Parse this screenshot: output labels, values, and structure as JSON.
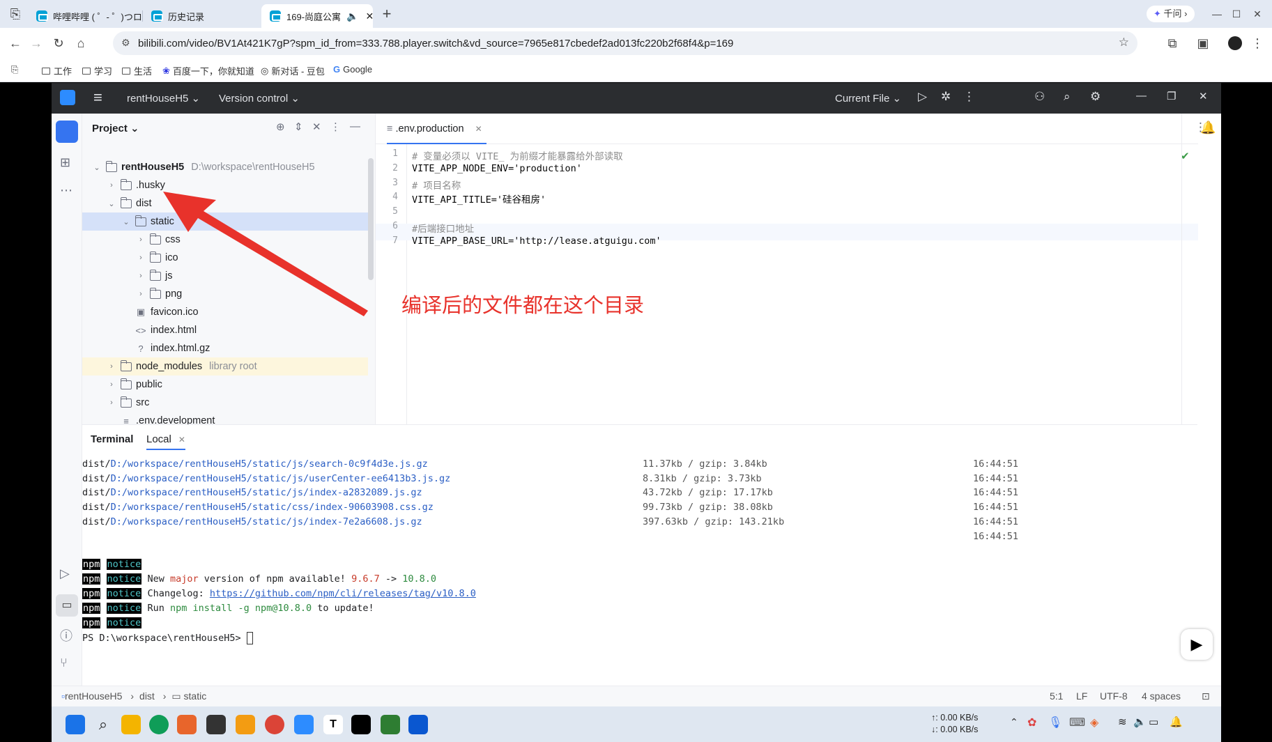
{
  "browser": {
    "tabs": [
      {
        "title": "哔哩哔哩 ( ゜- ゜)つロ 干杯~-bilibili",
        "active": false
      },
      {
        "title": "历史记录",
        "active": false
      },
      {
        "title": "169-尚庭公寓",
        "active": true
      }
    ],
    "qianwen_label": "千问",
    "url": "bilibili.com/video/BV1At421K7gP?spm_id_from=333.788.player.switch&vd_source=7965e817cbedef2ad013fc220b2f68f4&p=169",
    "bookmarks": [
      "工作",
      "学习",
      "生活",
      "百度一下，你就知道",
      "新对话 - 豆包",
      "Google"
    ]
  },
  "ide": {
    "project_name": "rentHouseH5",
    "version_control": "Version control",
    "run_config": "Current File",
    "project_panel_title": "Project",
    "tree": [
      {
        "name": "rentHouseH5",
        "extra": "D:\\workspace\\rentHouseH5",
        "depth": 0,
        "open": true,
        "type": "folder"
      },
      {
        "name": ".husky",
        "depth": 1,
        "open": false,
        "type": "folder"
      },
      {
        "name": "dist",
        "depth": 1,
        "open": true,
        "type": "folder"
      },
      {
        "name": "static",
        "depth": 2,
        "open": true,
        "type": "folder",
        "selected": true
      },
      {
        "name": "css",
        "depth": 3,
        "open": false,
        "type": "folder"
      },
      {
        "name": "ico",
        "depth": 3,
        "open": false,
        "type": "folder"
      },
      {
        "name": "js",
        "depth": 3,
        "open": false,
        "type": "folder"
      },
      {
        "name": "png",
        "depth": 3,
        "open": false,
        "type": "folder"
      },
      {
        "name": "favicon.ico",
        "depth": 2,
        "type": "file"
      },
      {
        "name": "index.html",
        "depth": 2,
        "type": "file"
      },
      {
        "name": "index.html.gz",
        "depth": 2,
        "type": "file"
      },
      {
        "name": "node_modules",
        "extra": "library root",
        "depth": 1,
        "open": false,
        "type": "folder",
        "highlight": true
      },
      {
        "name": "public",
        "depth": 1,
        "open": false,
        "type": "folder"
      },
      {
        "name": "src",
        "depth": 1,
        "open": false,
        "type": "folder"
      },
      {
        "name": ".env.development",
        "depth": 1,
        "type": "file"
      }
    ],
    "editor_tab": ".env.production",
    "code": [
      "# 变量必须以 VITE_ 为前缀才能暴露给外部读取",
      "VITE_APP_NODE_ENV='production'",
      "# 项目名称",
      "VITE_API_TITLE='硅谷租房'",
      "",
      "#后端接口地址",
      "VITE_APP_BASE_URL='http://lease.atguigu.com'"
    ],
    "terminal_tabs": [
      "Terminal",
      "Local"
    ],
    "terminal_files": [
      {
        "path": "dist/D:/workspace/rentHouseH5/static/js/search-0c9f4d3e.js.gz",
        "size": "11.37kb / gzip: 3.84kb",
        "time": "16:44:51"
      },
      {
        "path": "dist/D:/workspace/rentHouseH5/static/js/userCenter-ee6413b3.js.gz",
        "size": "8.31kb / gzip: 3.73kb",
        "time": "16:44:51"
      },
      {
        "path": "dist/D:/workspace/rentHouseH5/static/js/index-a2832089.js.gz",
        "size": "43.72kb / gzip: 17.17kb",
        "time": "16:44:51"
      },
      {
        "path": "dist/D:/workspace/rentHouseH5/static/css/index-90603908.css.gz",
        "size": "99.73kb / gzip: 38.08kb",
        "time": "16:44:51"
      },
      {
        "path": "dist/D:/workspace/rentHouseH5/static/js/index-7e2a6608.js.gz",
        "size": "397.63kb / gzip: 143.21kb",
        "time": "16:44:51"
      }
    ],
    "terminal_extra_time": "16:44:51",
    "npm_word": "npm",
    "notice_word": "notice",
    "npm_msg1_a": "New ",
    "npm_msg1_major": "major",
    "npm_msg1_b": " version of npm available! ",
    "npm_msg1_old": "9.6.7",
    "npm_msg1_arrow": " -> ",
    "npm_msg1_new": "10.8.0",
    "npm_changelog_label": "Changelog: ",
    "npm_changelog_url": "https://github.com/npm/cli/releases/tag/v10.8.0",
    "npm_run_a": "Run ",
    "npm_run_cmd": "npm install -g npm@10.8.0",
    "npm_run_b": " to update!",
    "prompt": "PS D:\\workspace\\rentHouseH5> ",
    "breadcrumb": [
      "rentHouseH5",
      "dist",
      "static"
    ],
    "status": {
      "position": "5:1",
      "line_ending": "LF",
      "encoding": "UTF-8",
      "indent": "4 spaces"
    }
  },
  "annotation_text": "编译后的文件都在这个目录",
  "net_speed": {
    "up": "↑: 0.00 KB/s",
    "down": "↓: 0.00 KB/s"
  }
}
